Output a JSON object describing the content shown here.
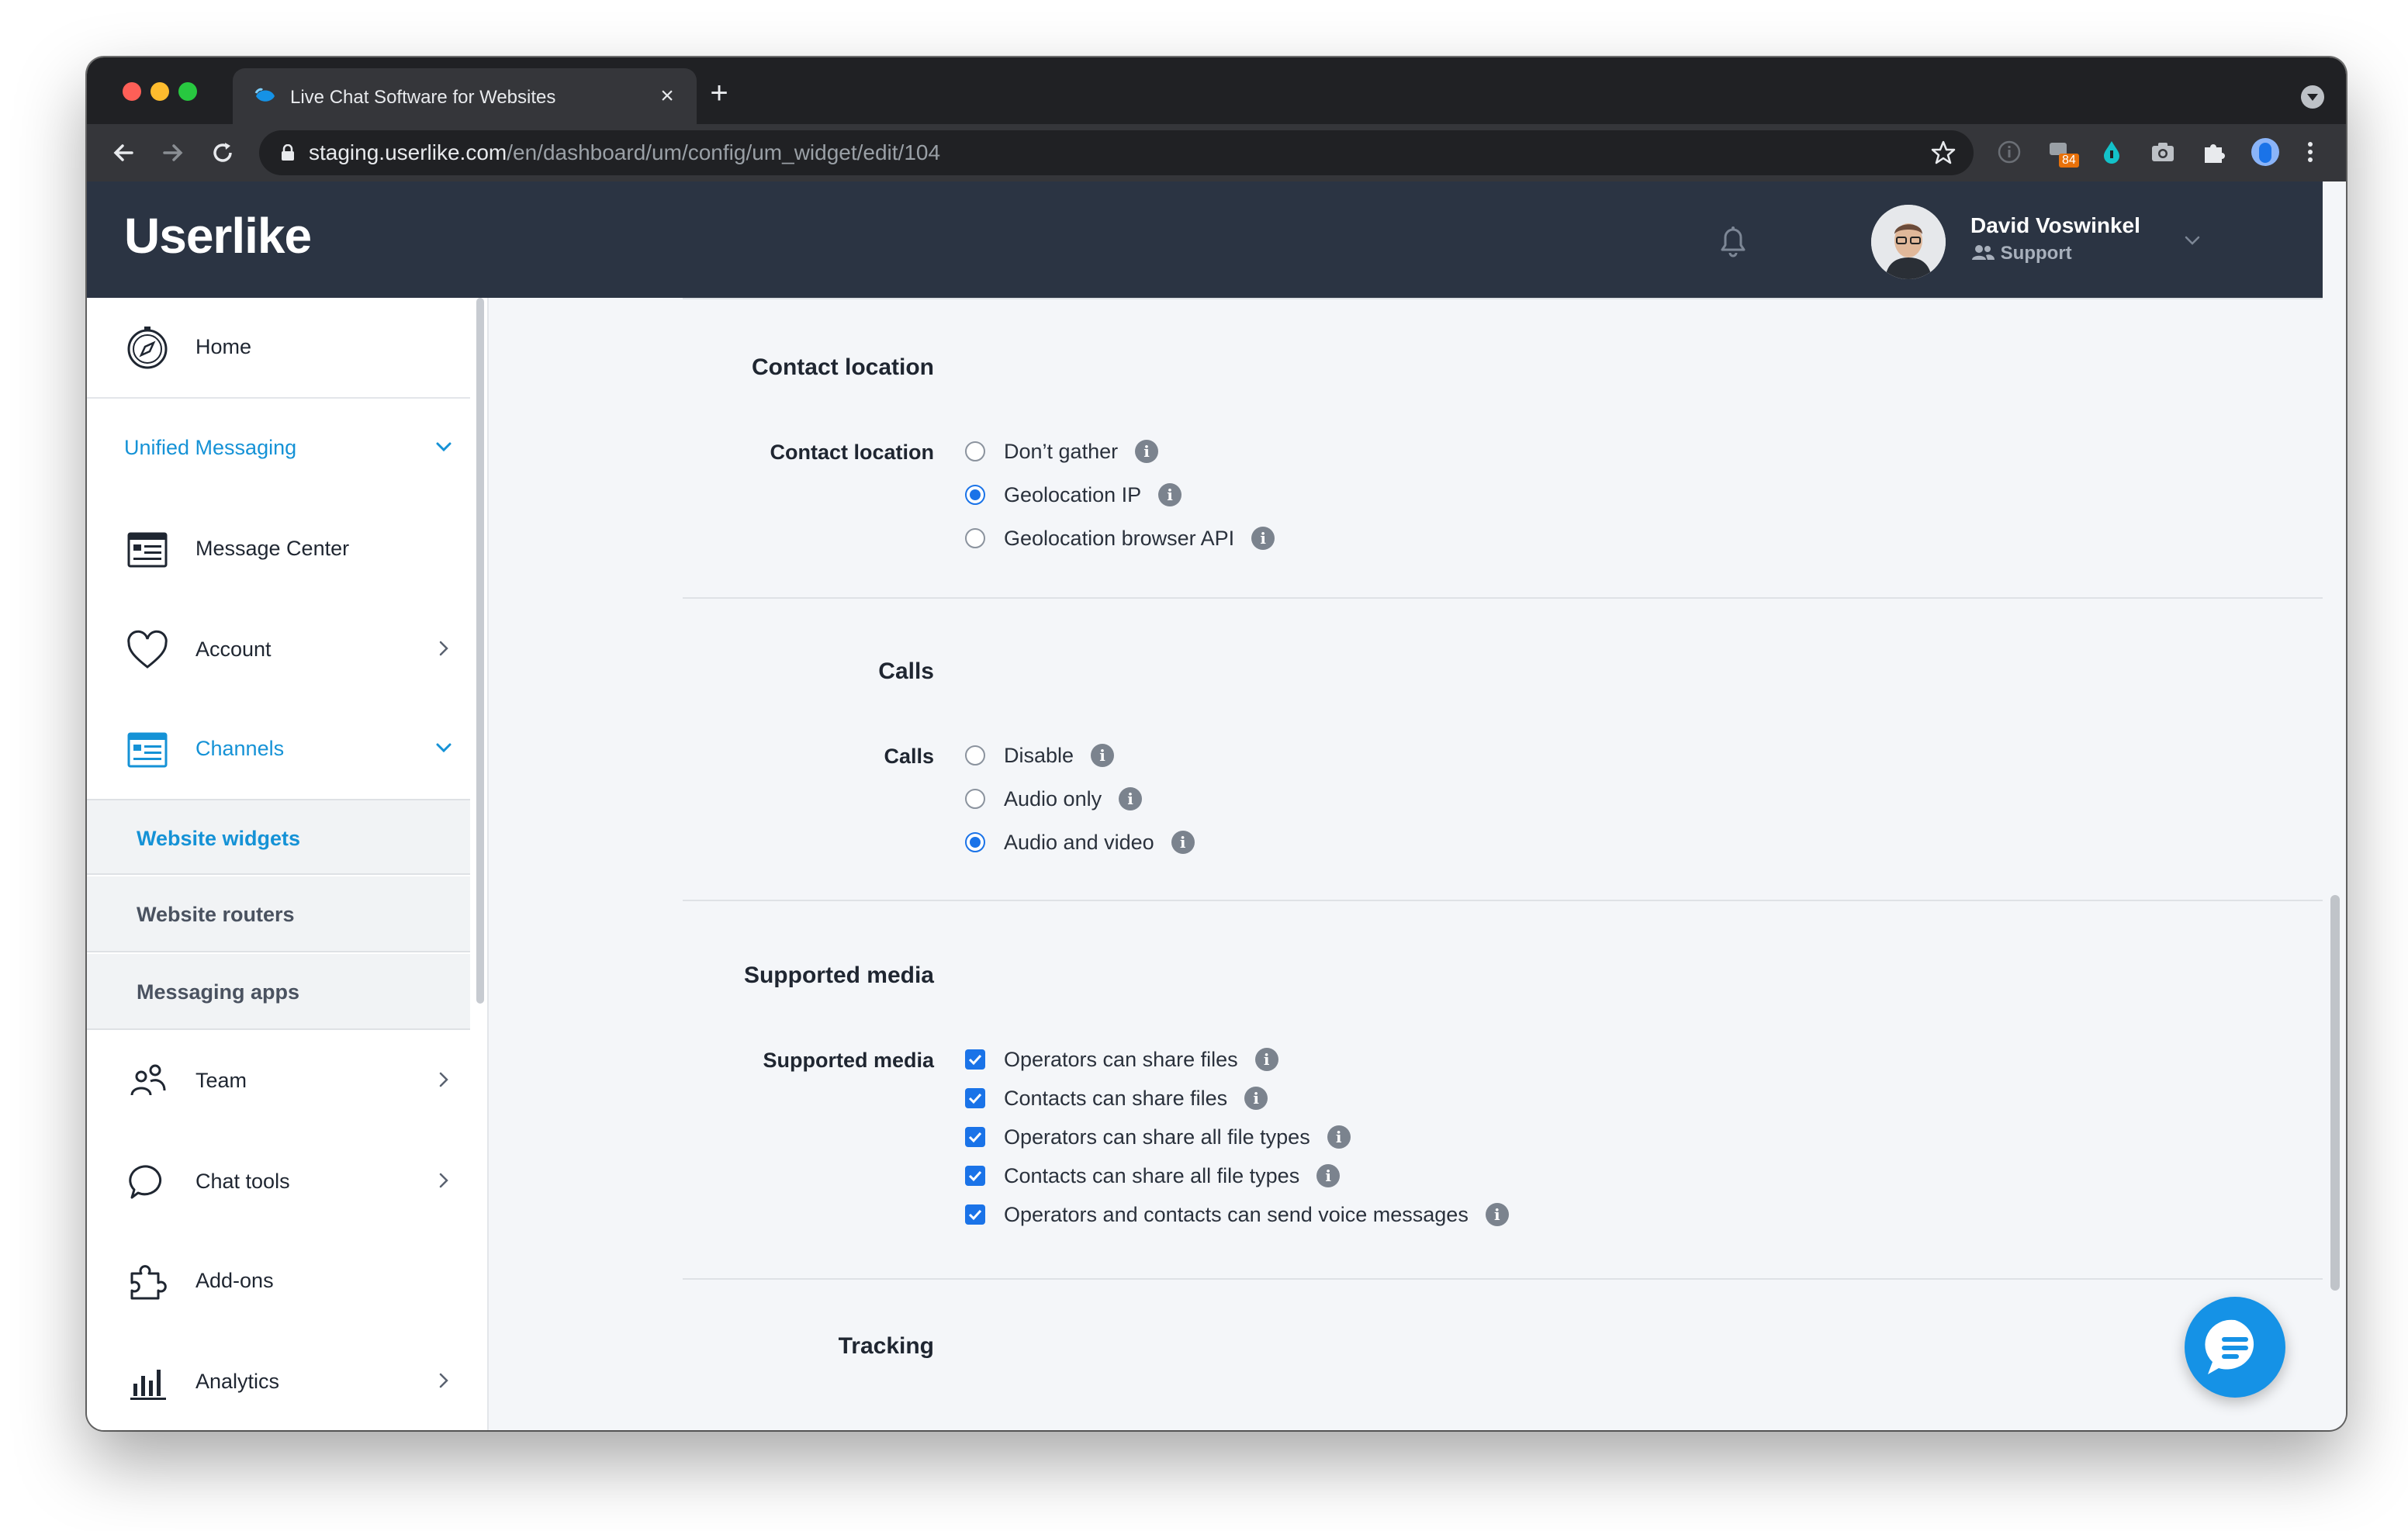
{
  "browser": {
    "tab_title": "Live Chat Software for Websites",
    "url_host": "staging.userlike.com",
    "url_path": "/en/dashboard/um/config/um_widget/edit/104",
    "extension_badge": "84"
  },
  "app": {
    "logo": "Userlike",
    "user": {
      "name": "David Voswinkel",
      "role": "Support"
    }
  },
  "sidebar": {
    "home": "Home",
    "unified_messaging": "Unified Messaging",
    "message_center": "Message Center",
    "account": "Account",
    "channels": "Channels",
    "channels_sub": [
      "Website widgets",
      "Website routers",
      "Messaging apps"
    ],
    "team": "Team",
    "chat_tools": "Chat tools",
    "addons": "Add-ons",
    "analytics": "Analytics"
  },
  "sections": {
    "contact_location": {
      "title": "Contact location",
      "label": "Contact location",
      "options": [
        "Don’t gather",
        "Geolocation IP",
        "Geolocation browser API"
      ],
      "selected": "Geolocation IP"
    },
    "calls": {
      "title": "Calls",
      "label": "Calls",
      "options": [
        "Disable",
        "Audio only",
        "Audio and video"
      ],
      "selected": "Audio and video"
    },
    "supported_media": {
      "title": "Supported media",
      "label": "Supported media",
      "options": [
        "Operators can share files",
        "Contacts can share files",
        "Operators can share all file types",
        "Contacts can share all file types",
        "Operators and contacts can send voice messages"
      ],
      "checked": [
        true,
        true,
        true,
        true,
        true
      ]
    },
    "tracking": {
      "title": "Tracking"
    }
  },
  "colors": {
    "accent": "#1592d6",
    "header": "#2b3443",
    "checkbox": "#1a73e8"
  }
}
